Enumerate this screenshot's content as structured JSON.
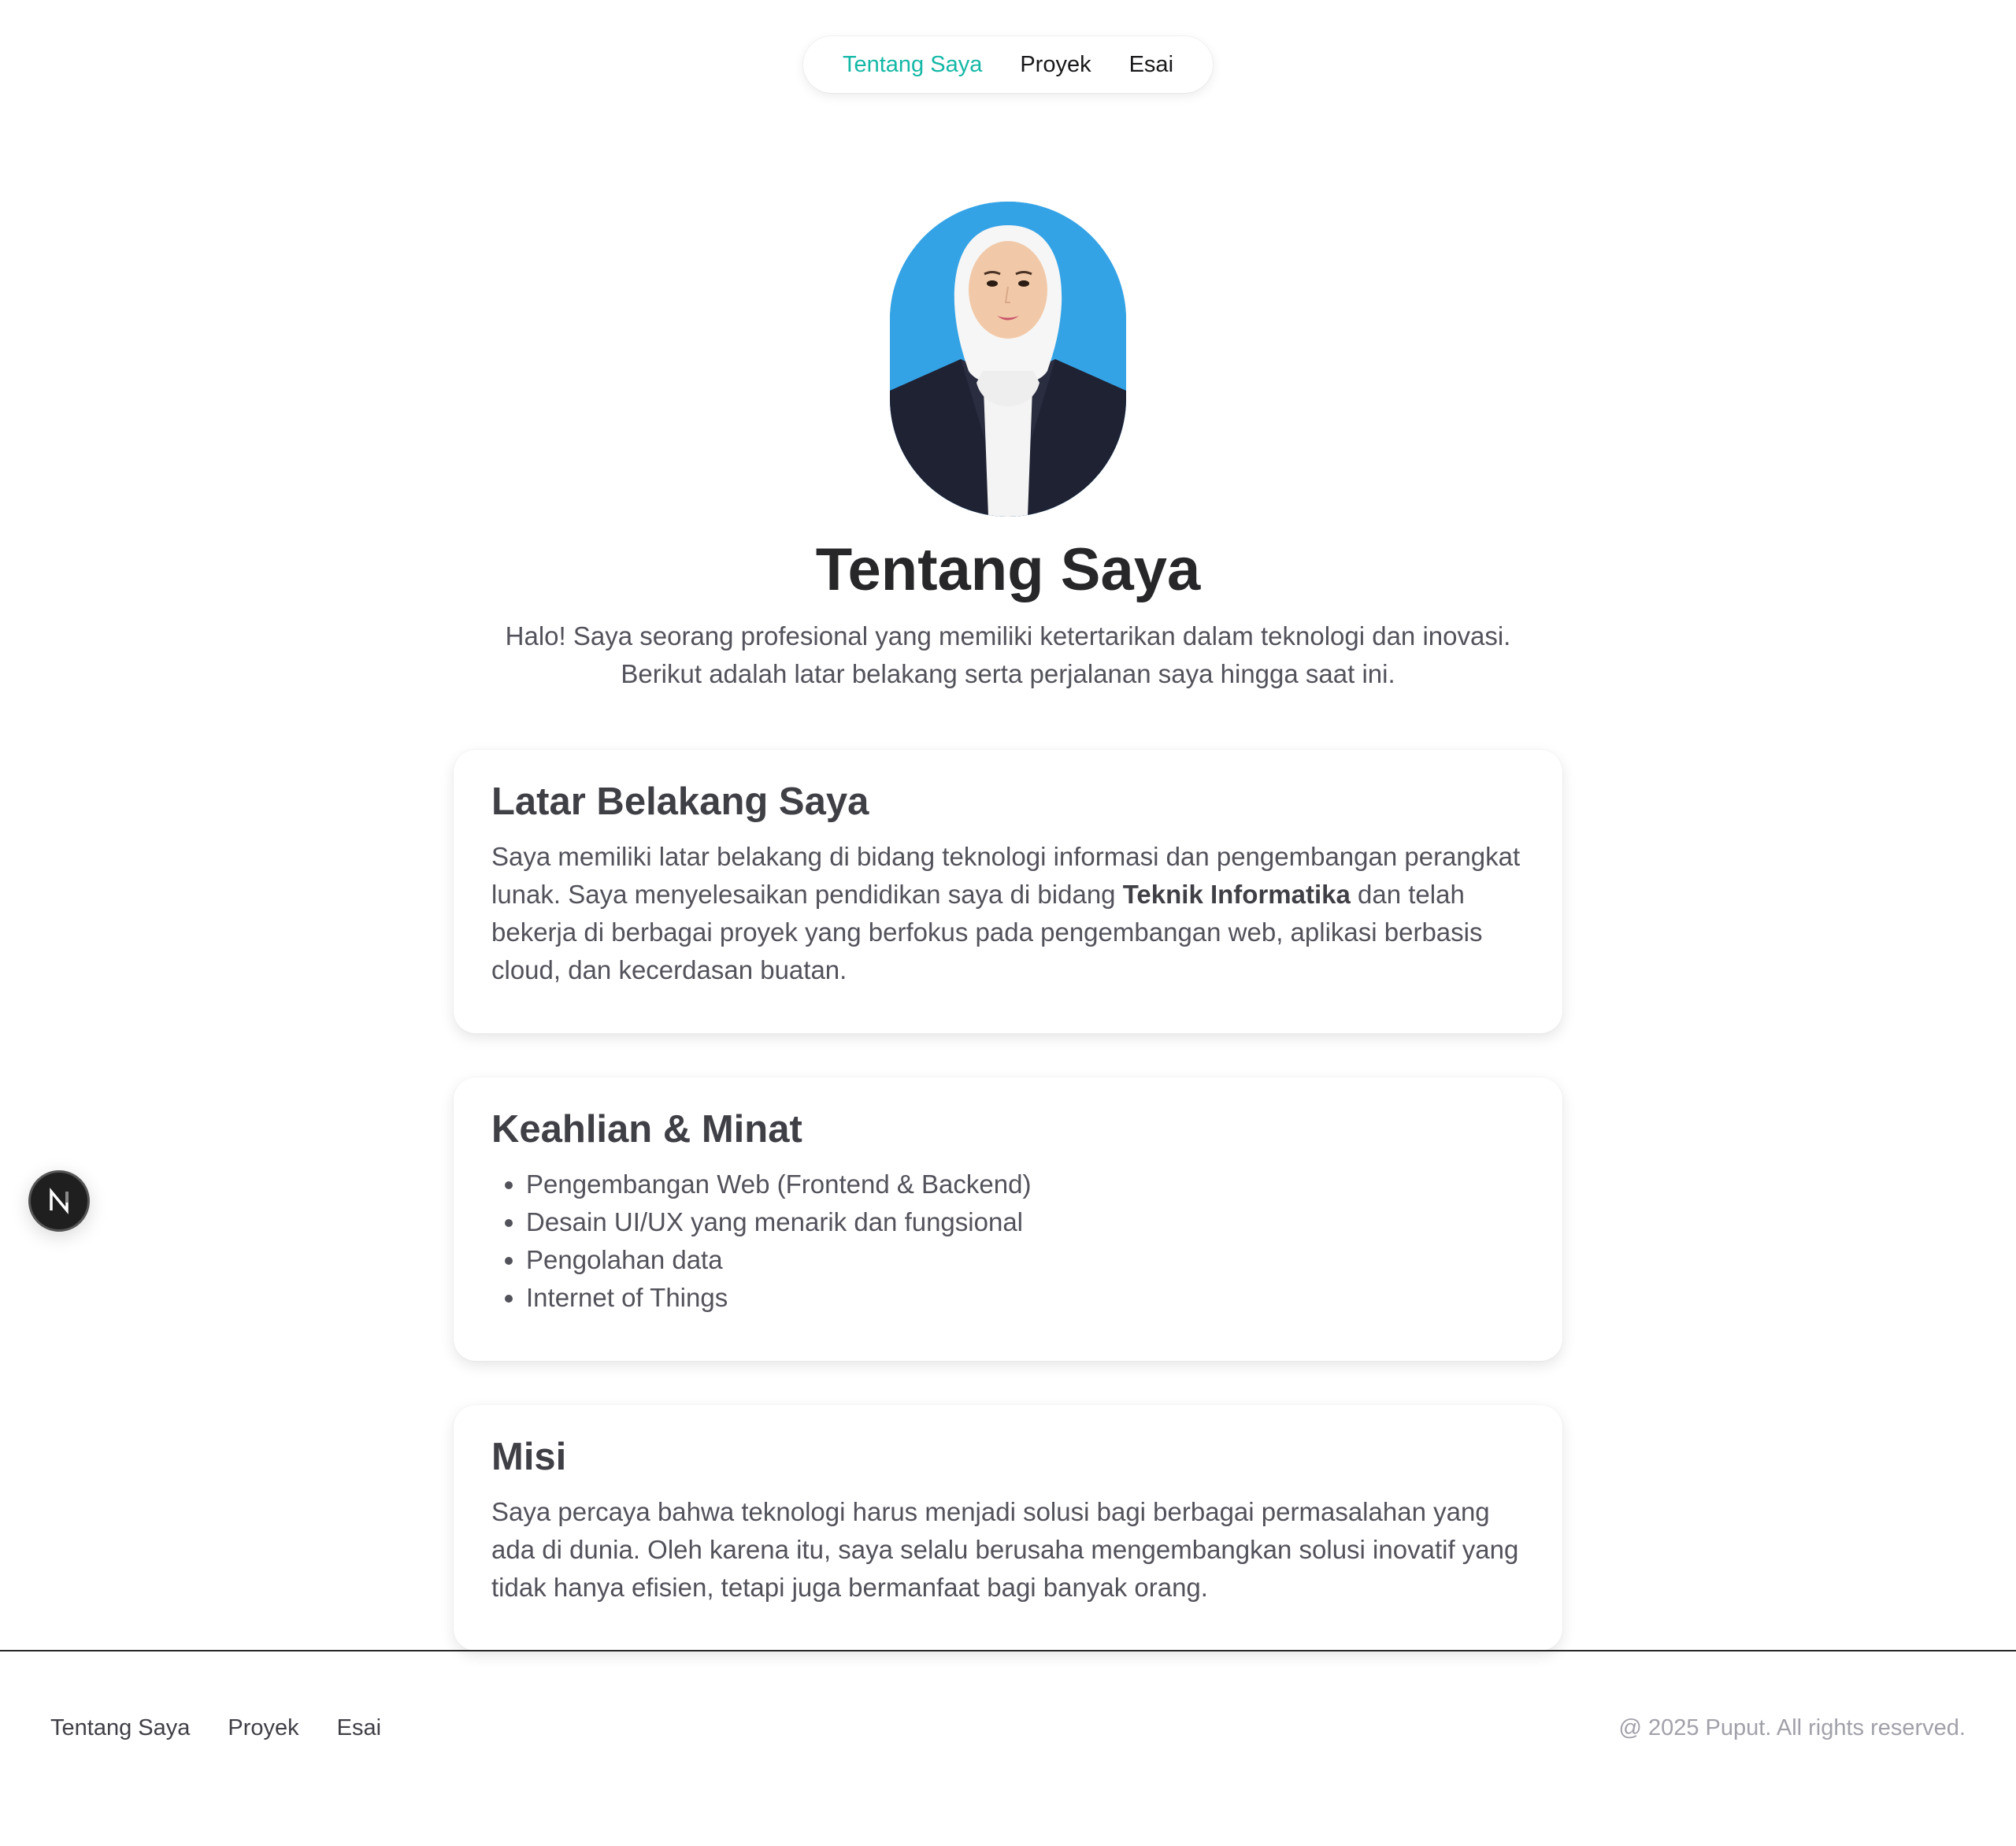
{
  "nav": {
    "items": [
      {
        "label": "Tentang Saya",
        "active": true
      },
      {
        "label": "Proyek",
        "active": false
      },
      {
        "label": "Esai",
        "active": false
      }
    ]
  },
  "profile": {
    "avatar_alt": "profile-photo"
  },
  "hero": {
    "title": "Tentang Saya",
    "intro_line1": "Halo! Saya seorang profesional yang memiliki ketertarikan dalam teknologi dan inovasi.",
    "intro_line2": "Berikut adalah latar belakang serta perjalanan saya hingga saat ini."
  },
  "background": {
    "title": "Latar Belakang Saya",
    "text_before": "Saya memiliki latar belakang di bidang teknologi informasi dan pengembangan perangkat lunak. Saya menyelesaikan pendidikan saya di bidang ",
    "text_bold": "Teknik Informatika",
    "text_after": " dan telah bekerja di berbagai proyek yang berfokus pada pengembangan web, aplikasi berbasis cloud, dan kecerdasan buatan."
  },
  "skills": {
    "title": "Keahlian & Minat",
    "items": [
      "Pengembangan Web (Frontend & Backend)",
      "Desain UI/UX yang menarik dan fungsional",
      "Pengolahan data",
      "Internet of Things"
    ]
  },
  "mission": {
    "title": "Misi",
    "text": "Saya percaya bahwa teknologi harus menjadi solusi bagi berbagai permasalahan yang ada di dunia. Oleh karena itu, saya selalu berusaha mengembangkan solusi inovatif yang tidak hanya efisien, tetapi juga bermanfaat bagi banyak orang."
  },
  "badge": {
    "letter": "N"
  },
  "footer": {
    "links": [
      "Tentang Saya",
      "Proyek",
      "Esai"
    ],
    "copyright": "@ 2025 Puput. All rights reserved."
  },
  "colors": {
    "accent": "#14b8a6",
    "avatar_bg": "#34a3e6"
  }
}
